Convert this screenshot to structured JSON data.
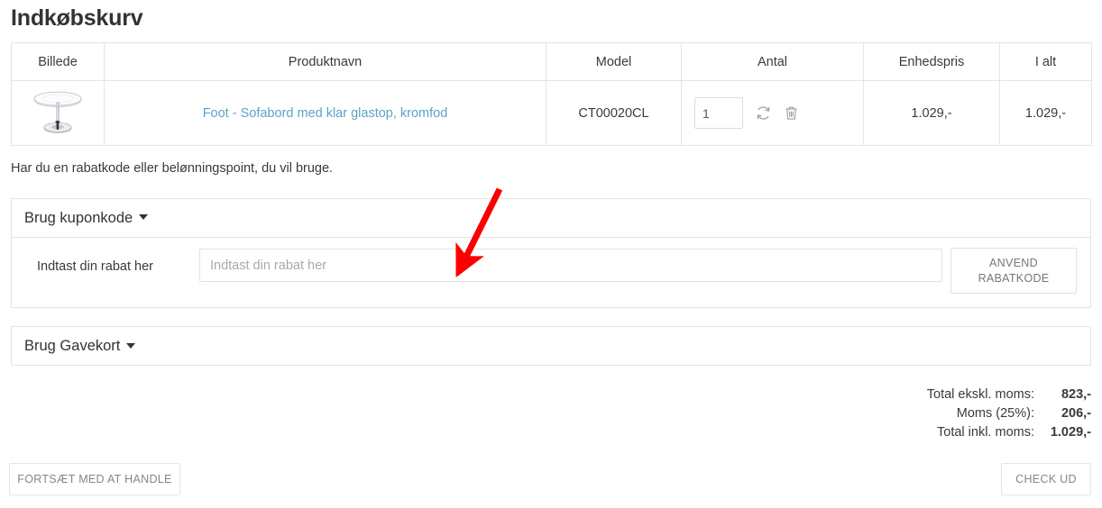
{
  "page": {
    "title": "Indkøbskurv"
  },
  "cart_table": {
    "headers": [
      "Billede",
      "Produktnavn",
      "Model",
      "Antal",
      "Enhedspris",
      "I alt"
    ],
    "rows": [
      {
        "image_alt": "glass-top-coffee-table",
        "product_name": "Foot - Sofabord med klar glastop, kromfod",
        "model": "CT00020CL",
        "quantity": "1",
        "unit_price": "1.029,-",
        "total": "1.029,-",
        "update_icon": "refresh-icon",
        "remove_icon": "trash-icon"
      }
    ]
  },
  "discount": {
    "intro": "Har du en rabatkode eller belønningspoint, du vil bruge.",
    "coupon_panel_title": "Brug kuponkode",
    "coupon_label": "Indtast din rabat her",
    "coupon_placeholder": "Indtast din rabat her",
    "coupon_value": "",
    "apply_button_line1": "ANVEND",
    "apply_button_line2": "RABATKODE",
    "giftcard_panel_title": "Brug Gavekort"
  },
  "totals": [
    {
      "label": "Total ekskl. moms:",
      "value": "823,-"
    },
    {
      "label": "Moms (25%):",
      "value": "206,-"
    },
    {
      "label": "Total inkl. moms:",
      "value": "1.029,-"
    }
  ],
  "actions": {
    "continue_shopping": "FORTSÆT MED AT HANDLE",
    "checkout": "CHECK UD"
  },
  "colors": {
    "link": "#5ba3c5",
    "border": "#e4e4e4",
    "text": "#3a3a3a",
    "muted": "#85868a",
    "annotation": "#fa0000"
  }
}
